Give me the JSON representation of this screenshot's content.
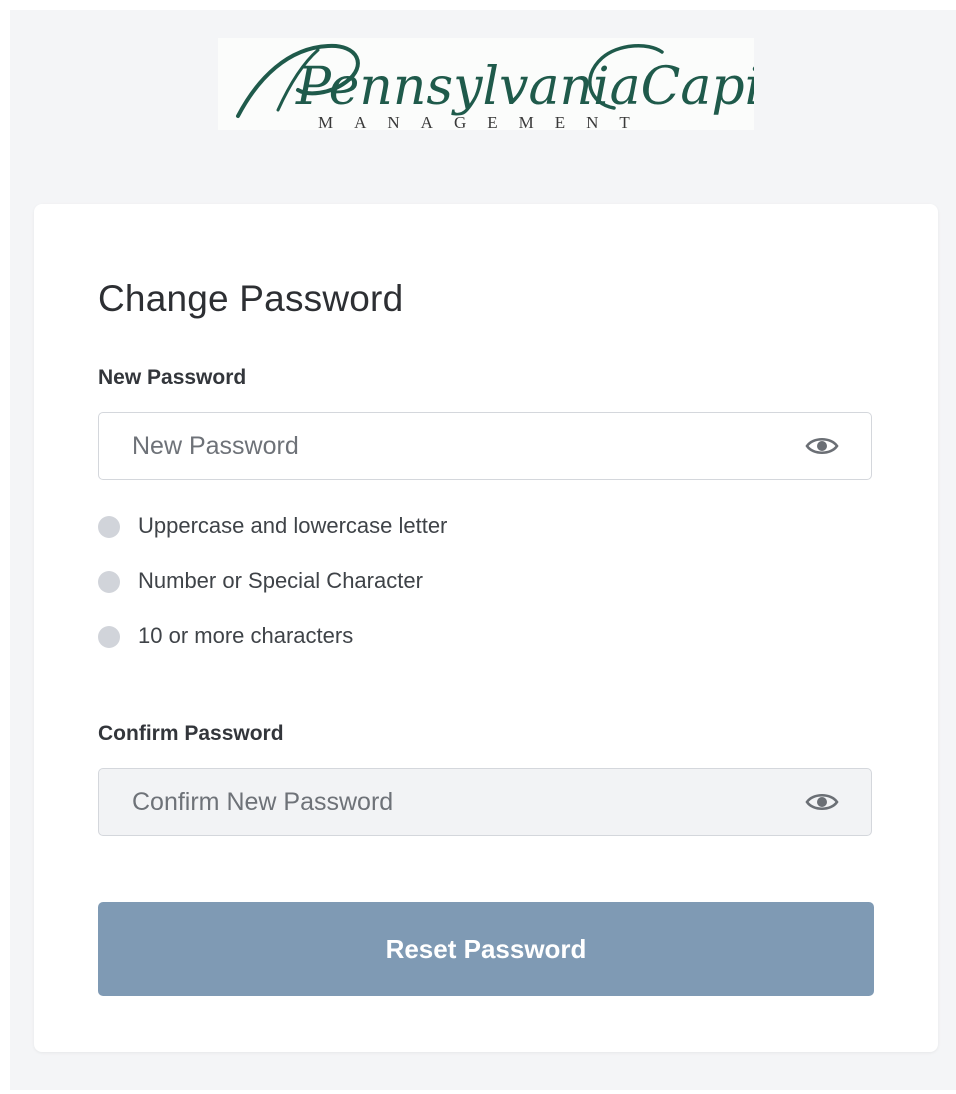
{
  "brand": {
    "name_script": "PennsylvaniaCapital",
    "tagline": "MANAGEMENT",
    "color": "#1f5a4b"
  },
  "form": {
    "title": "Change Password",
    "new_password": {
      "label": "New Password",
      "placeholder": "New Password",
      "value": "",
      "toggle_icon": "eye-icon"
    },
    "requirements": [
      {
        "text": "Uppercase and lowercase letter",
        "met": false
      },
      {
        "text": "Number or Special Character",
        "met": false
      },
      {
        "text": "10 or more characters",
        "met": false
      }
    ],
    "confirm_password": {
      "label": "Confirm Password",
      "placeholder": "Confirm New Password",
      "value": "",
      "disabled": true,
      "toggle_icon": "eye-icon"
    },
    "submit_label": "Reset Password"
  },
  "colors": {
    "page_bg": "#f4f5f7",
    "card_bg": "#ffffff",
    "button_bg": "#7f9ab4",
    "requirement_dot": "#d1d4da",
    "text": "#2d2f33"
  }
}
